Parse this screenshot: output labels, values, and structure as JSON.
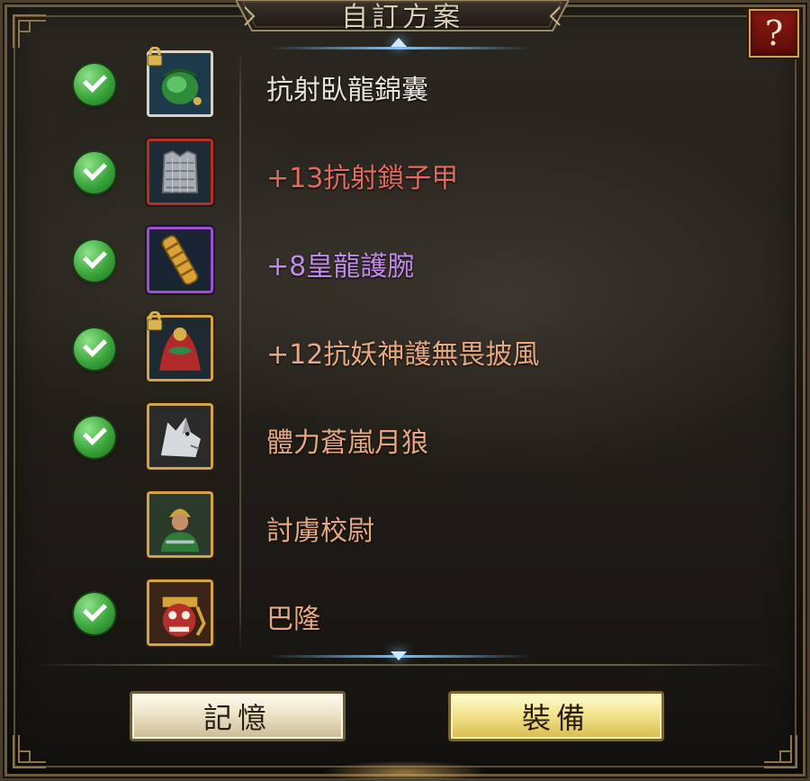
{
  "window": {
    "title": "自訂方案"
  },
  "help": {
    "label": "?"
  },
  "colors": {
    "name_white": "#e8e4dc",
    "name_red": "#e36a5e",
    "name_purple": "#c08be8",
    "name_orange": "#e6a882"
  },
  "items": [
    {
      "name": "抗射臥龍錦囊",
      "checked": true,
      "locked": true,
      "icon": "green-pouch-icon",
      "rarity": "white",
      "color": "#e8e4dc"
    },
    {
      "name": "+13抗射鎖子甲",
      "checked": true,
      "locked": false,
      "icon": "chain-armor-icon",
      "rarity": "red",
      "color": "#e36a5e"
    },
    {
      "name": "+8皇龍護腕",
      "checked": true,
      "locked": false,
      "icon": "gold-bracer-icon",
      "rarity": "purple",
      "color": "#c08be8"
    },
    {
      "name": "+12抗妖神護無畏披風",
      "checked": true,
      "locked": true,
      "icon": "dragon-cape-icon",
      "rarity": "gold",
      "color": "#e6a882"
    },
    {
      "name": "體力蒼嵐月狼",
      "checked": true,
      "locked": false,
      "icon": "white-wolf-icon",
      "rarity": "gold",
      "color": "#e6a882"
    },
    {
      "name": "討虜校尉",
      "checked": false,
      "locked": false,
      "icon": "general-portrait-icon",
      "rarity": "gold",
      "color": "#e6a882"
    },
    {
      "name": "巴隆",
      "checked": true,
      "locked": false,
      "icon": "barong-mask-icon",
      "rarity": "gold",
      "color": "#e6a882"
    }
  ],
  "buttons": {
    "memory": "記憶",
    "equip": "裝備"
  }
}
